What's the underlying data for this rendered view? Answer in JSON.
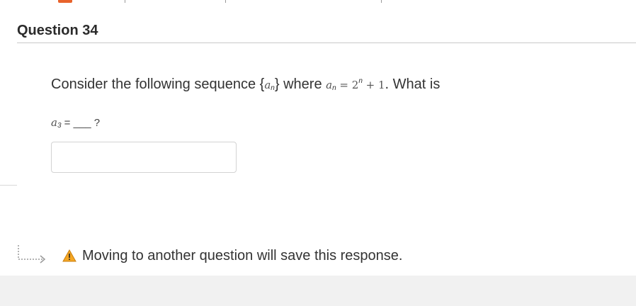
{
  "question": {
    "title": "Question 34",
    "prompt_prefix": "Consider the following sequence",
    "prompt_mid": "where",
    "prompt_suffix": ". What is",
    "seq_open": "{",
    "seq_var": "a",
    "seq_sub": "n",
    "seq_close": "}",
    "formula_lhs_var": "a",
    "formula_lhs_sub": "n",
    "formula_eq": " = ",
    "formula_base": "2",
    "formula_exp": "n",
    "formula_rest": " + 1",
    "line2_var": "a",
    "line2_sub": "3",
    "line2_blank": " = ___ ?",
    "answer_value": "",
    "answer_placeholder": ""
  },
  "notice": {
    "text": "Moving to another question will save this response.",
    "icon": "warning-icon",
    "arrow_icon": "dotted-arrow-icon"
  },
  "colors": {
    "warning": "#f5a623",
    "accent": "#e8632b"
  }
}
